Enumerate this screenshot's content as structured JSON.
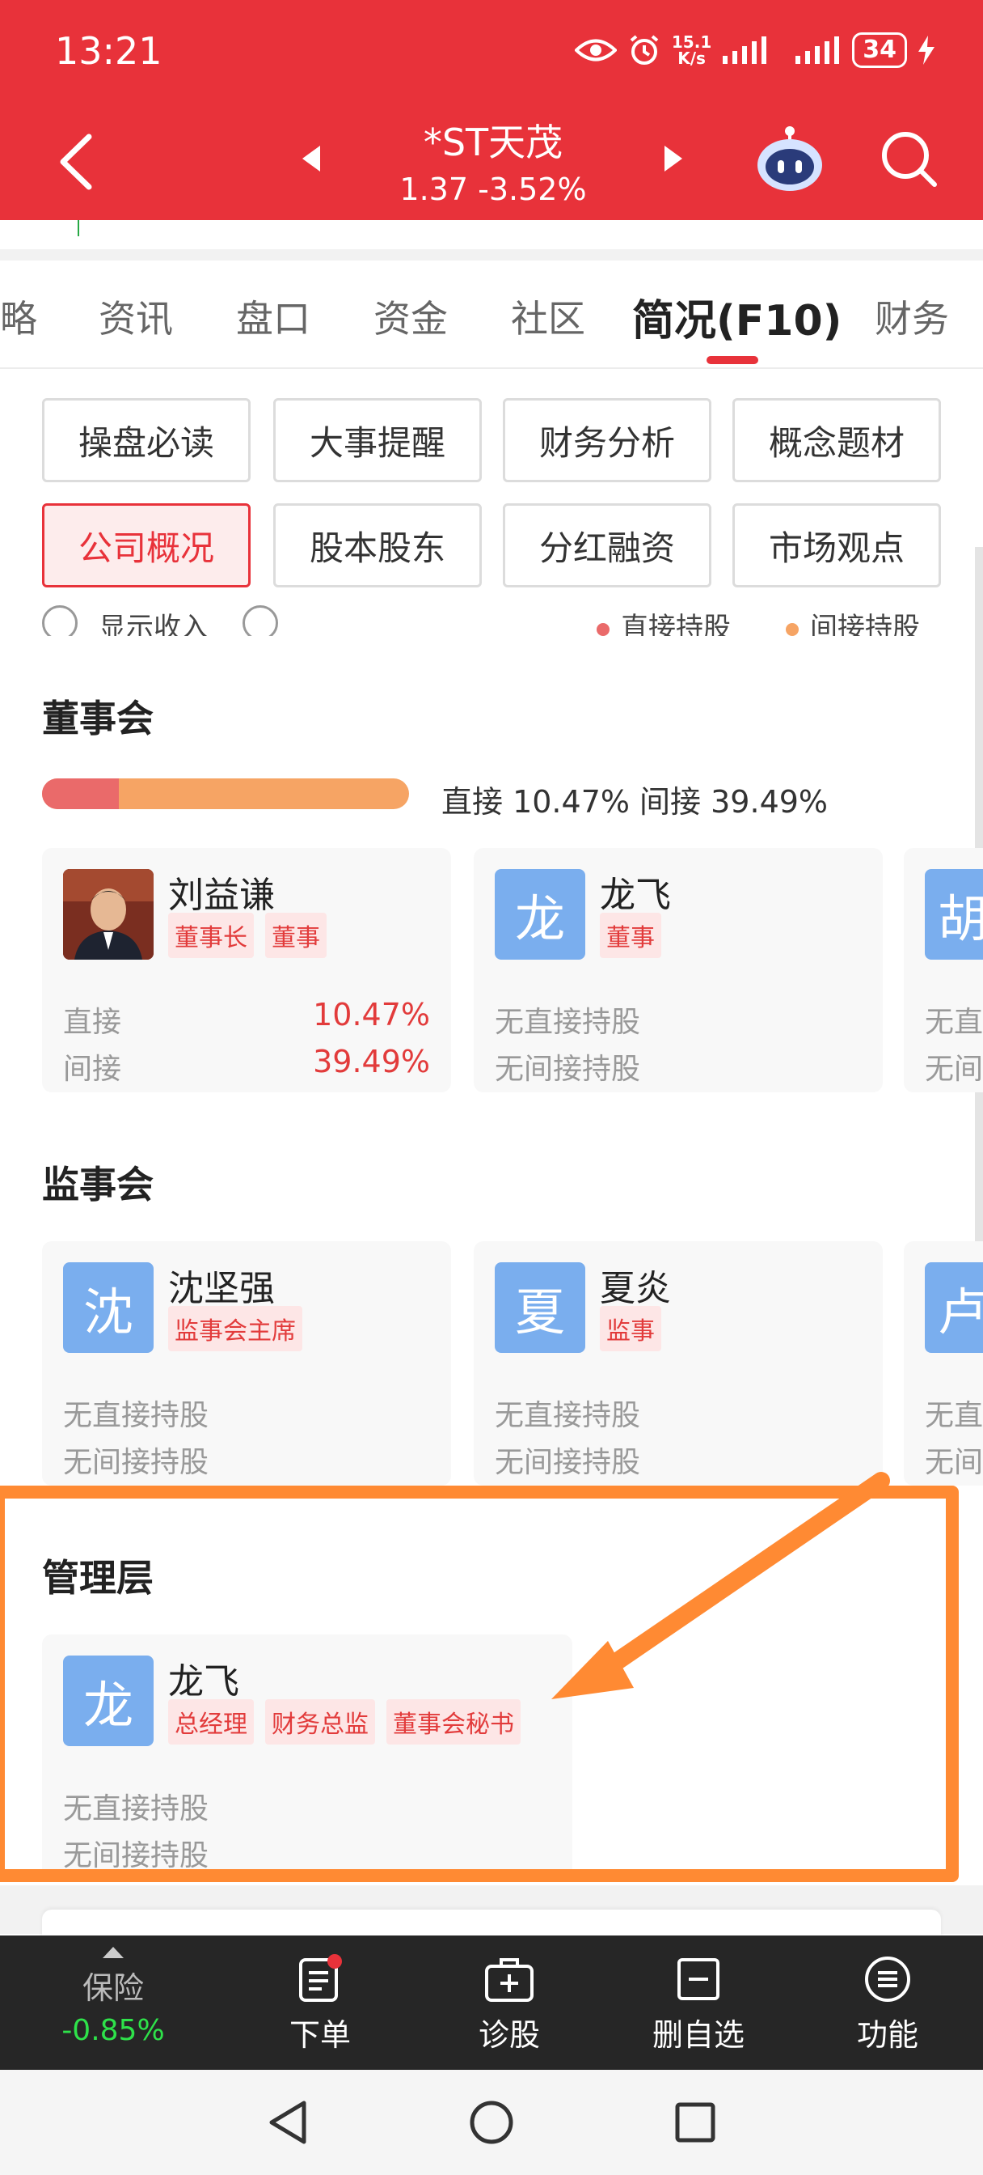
{
  "status_bar": {
    "time": "13:21",
    "speed_top": "15.1",
    "speed_bottom": "K/s",
    "battery": "34"
  },
  "header": {
    "stock_name": "*ST天茂",
    "price": "1.37",
    "change": "-3.52%",
    "icons": [
      "back-arrow-icon",
      "prev-triangle-icon",
      "next-triangle-icon",
      "robot-assistant-icon",
      "search-icon"
    ]
  },
  "tabs": [
    "略",
    "资讯",
    "盘口",
    "资金",
    "社区",
    "简况(F10)",
    "财务"
  ],
  "active_tab": "简况(F10)",
  "chips": {
    "row1": [
      "操盘必读",
      "大事提醒",
      "财务分析",
      "概念题材"
    ],
    "row2": [
      "公司概况",
      "股本股东",
      "分红融资",
      "市场观点"
    ],
    "active": "公司概况"
  },
  "legend": {
    "radio_label": "显示收入",
    "direct": "直接持股",
    "indirect": "间接持股"
  },
  "board": {
    "title": "董事会",
    "summary": "直接 10.47% 间接 39.49%",
    "direct_share": 10.47,
    "members": [
      {
        "avatar": "",
        "name": "刘益谦",
        "tags": [
          "董事长",
          "董事"
        ],
        "direct_label": "直接",
        "direct_value": "10.47%",
        "indirect_label": "间接",
        "indirect_value": "39.49%"
      },
      {
        "avatar": "龙",
        "name": "龙飞",
        "tags": [
          "董事"
        ],
        "line1": "无直接持股",
        "line2": "无间接持股"
      },
      {
        "avatar": "胡",
        "name": "",
        "tags": [],
        "line1": "无直",
        "line2": "无间"
      }
    ]
  },
  "supervisors": {
    "title": "监事会",
    "members": [
      {
        "avatar": "沈",
        "name": "沈坚强",
        "tags": [
          "监事会主席"
        ],
        "line1": "无直接持股",
        "line2": "无间接持股"
      },
      {
        "avatar": "夏",
        "name": "夏炎",
        "tags": [
          "监事"
        ],
        "line1": "无直接持股",
        "line2": "无间接持股"
      },
      {
        "avatar": "卢",
        "name": "",
        "tags": [],
        "line1": "无直",
        "line2": "无间"
      }
    ]
  },
  "management": {
    "title": "管理层",
    "members": [
      {
        "avatar": "龙",
        "name": "龙飞",
        "tags": [
          "总经理",
          "财务总监",
          "董事会秘书"
        ],
        "line1": "无直接持股",
        "line2": "无间接持股"
      }
    ]
  },
  "toolbar": {
    "insurance_label": "保险",
    "insurance_value": "-0.85%",
    "order": "下单",
    "diagnose": "诊股",
    "remove_watch": "删自选",
    "functions": "功能"
  },
  "colors": {
    "brand_red": "#e8323a",
    "highlight_orange": "#ff8a33",
    "tag_red": "#e23b3b",
    "avatar_blue": "#7aaeee",
    "gain_green": "#2ee24a"
  }
}
